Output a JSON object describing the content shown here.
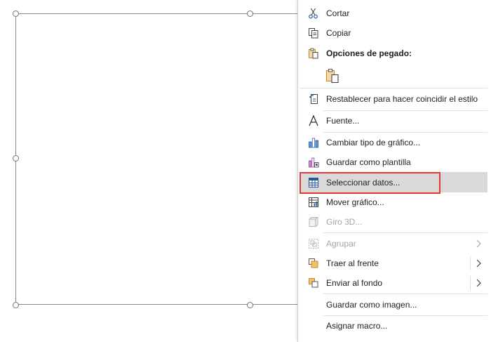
{
  "menu": {
    "cut": "Cortar",
    "copy": "Copiar",
    "paste_options": "Opciones de pegado:",
    "reset_style": "Restablecer para hacer coincidir el estilo",
    "font": "Fuente...",
    "change_chart_type": "Cambiar tipo de gráfico...",
    "save_template": "Guardar como plantilla",
    "select_data": "Seleccionar datos...",
    "move_chart": "Mover gráfico...",
    "rotate_3d": "Giro 3D...",
    "group": "Agrupar",
    "bring_front": "Traer al frente",
    "send_back": "Enviar al fondo",
    "save_image": "Guardar como imagen...",
    "assign_macro": "Asignar macro..."
  },
  "colors": {
    "accent_blue": "#2b579a",
    "paste_orange": "#c8872a",
    "highlight_red": "#e53935",
    "hover_gray": "#d9d9d9"
  }
}
